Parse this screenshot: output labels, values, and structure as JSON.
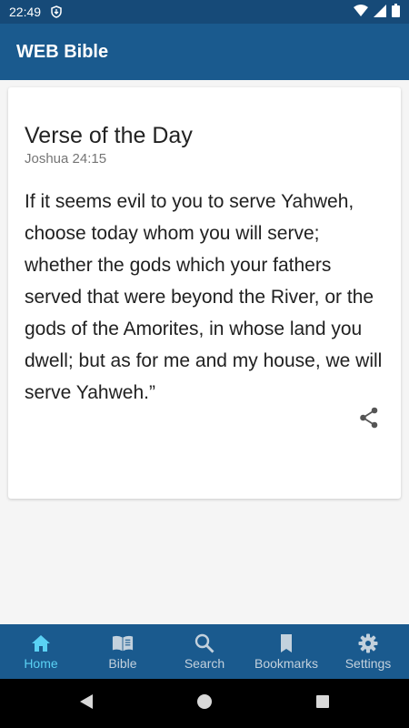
{
  "status_bar": {
    "time": "22:49",
    "notification_icon": "download-shield-icon",
    "wifi_icon": "wifi-icon",
    "signal_icon": "signal-icon",
    "battery_icon": "battery-icon"
  },
  "app_bar": {
    "title": "WEB Bible"
  },
  "verse_card": {
    "title": "Verse of the Day",
    "reference": "Joshua 24:15",
    "text": "If it seems evil to you to serve Yahweh, choose today whom you will serve; whether the gods which your fathers served that were beyond the River, or the gods of the Amorites, in whose land you dwell; but as for me and my house, we will serve Yahweh.”",
    "share_icon": "share-icon"
  },
  "bottom_nav": {
    "items": [
      {
        "label": "Home",
        "icon": "home-icon",
        "active": true
      },
      {
        "label": "Bible",
        "icon": "book-icon",
        "active": false
      },
      {
        "label": "Search",
        "icon": "search-icon",
        "active": false
      },
      {
        "label": "Bookmarks",
        "icon": "bookmark-icon",
        "active": false
      },
      {
        "label": "Settings",
        "icon": "gear-icon",
        "active": false
      }
    ]
  },
  "colors": {
    "status_bar": "#164a78",
    "app_bar": "#1a5a8e",
    "bottom_nav": "#1a5a8e",
    "active_nav": "#5ad1f4",
    "inactive_nav": "#c3d1dd"
  }
}
